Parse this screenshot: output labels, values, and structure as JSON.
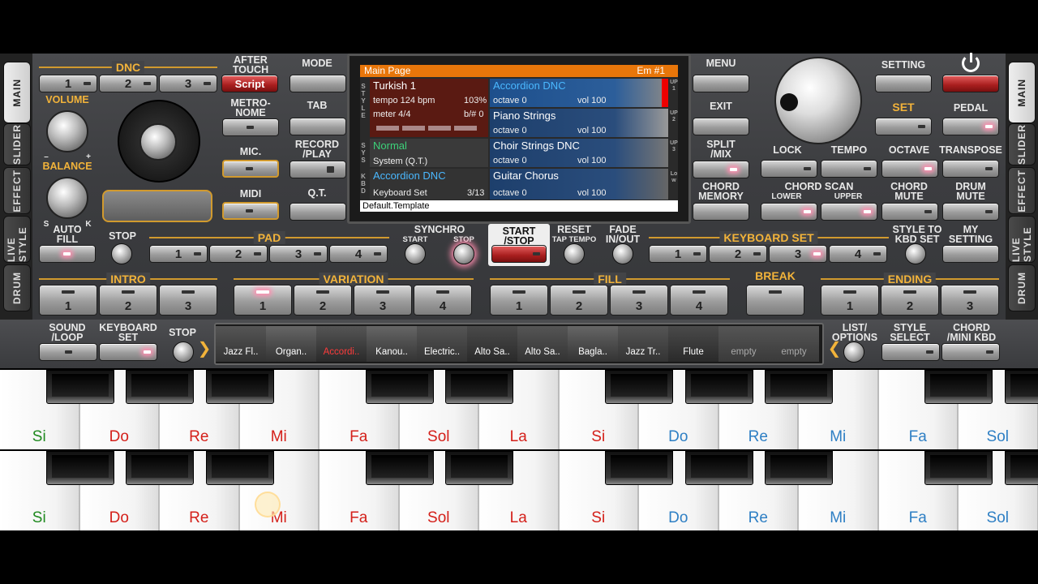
{
  "tabs_left": [
    "MAIN",
    "SLIDER",
    "EFFECT",
    "LIVE STYLE",
    "DRUM"
  ],
  "tabs_right": [
    "MAIN",
    "SLIDER",
    "EFFECT",
    "LIVE STYLE",
    "DRUM"
  ],
  "dnc": {
    "title": "DNC",
    "buttons": [
      "1",
      "2",
      "3"
    ],
    "script": "Script"
  },
  "labels": {
    "after_touch": "AFTER\nTOUCH",
    "volume": "VOLUME",
    "balance": "BALANCE",
    "s": "S",
    "k": "K",
    "minus": "–",
    "plus": "+",
    "metronome": "METRO-\nNOME",
    "mic": "MIC.",
    "midi": "MIDI",
    "mode": "MODE",
    "tab": "TAB",
    "record_play": "RECORD\n/PLAY",
    "qt": "Q.T.",
    "menu": "MENU",
    "exit": "EXIT",
    "split_mix": "SPLIT\n/MIX",
    "chord_memory": "CHORD\nMEMORY",
    "setting": "SETTING",
    "set": "SET",
    "pedal": "PEDAL",
    "lock": "LOCK",
    "tempo": "TEMPO",
    "octave": "OCTAVE",
    "transpose": "TRANSPOSE",
    "chord_scan": "CHORD SCAN",
    "lower": "LOWER",
    "upper": "UPPER",
    "chord_mute": "CHORD\nMUTE",
    "drum_mute": "DRUM\nMUTE",
    "auto_fill": "AUTO\nFILL",
    "stop": "STOP",
    "pad": "PAD",
    "synchro": "SYNCHRO",
    "start": "START",
    "start_stop": "START\n/STOP",
    "reset": "RESET",
    "tap_tempo": "TAP TEMPO",
    "fade": "FADE\nIN/OUT",
    "keyboard_set": "KEYBOARD SET",
    "style_to_kbd": "STYLE TO\nKBD SET",
    "my_setting": "MY\nSETTING",
    "intro": "INTRO",
    "variation": "VARIATION",
    "fill": "FILL",
    "break": "BREAK",
    "ending": "ENDING",
    "sound_loop": "SOUND\n/LOOP",
    "keyboard_set2": "KEYBOARD\nSET",
    "list_options": "LIST/\nOPTIONS",
    "style_select": "STYLE\nSELECT",
    "chord_mini": "CHORD\n/MINI KBD"
  },
  "screen": {
    "title": "Main Page",
    "corner": "Em #1",
    "style": {
      "name": "Turkish 1",
      "tempo": "tempo 124 bpm",
      "pct": "103%",
      "meter": "meter 4/4",
      "bsharp": "b/# 0"
    },
    "sys": {
      "name": "Normal",
      "sub": "System (Q.T.)"
    },
    "kbd": {
      "name": "Accordion DNC",
      "sub": "Keyboard Set",
      "count": "3/13"
    },
    "parts": [
      {
        "name": "Accordion DNC",
        "octave": "octave  0",
        "vol": "vol 100",
        "side": "UP1"
      },
      {
        "name": "Piano Strings",
        "octave": "octave  0",
        "vol": "vol 100",
        "side": "UP2"
      },
      {
        "name": "Choir Strings DNC",
        "octave": "octave  0",
        "vol": "vol 100",
        "side": "UP3"
      },
      {
        "name": "Guitar Chorus",
        "octave": "octave  0",
        "vol": "vol 100",
        "side": "Low"
      }
    ],
    "footer": "Default.Template",
    "side_style": "STYLE",
    "side_sys": "SYS",
    "side_kbd": "KBD"
  },
  "numbers": {
    "one": "1",
    "two": "2",
    "three": "3",
    "four": "4"
  },
  "sounds": [
    "Jazz Fl..",
    "Organ..",
    "Accordi..",
    "Kanou..",
    "Electric..",
    "Alto Sa..",
    "Alto Sa..",
    "Bagla..",
    "Jazz Tr..",
    "Flute",
    "empty",
    "empty"
  ],
  "keys_row": [
    "Si",
    "Do",
    "Re",
    "Mi",
    "Fa",
    "Sol",
    "La",
    "Si",
    "Do",
    "Re",
    "Mi",
    "Fa",
    "Sol"
  ],
  "colors": {
    "accent": "#f2b33a",
    "active_led": "#ff8fb0",
    "screen_head": "#e8760a"
  }
}
